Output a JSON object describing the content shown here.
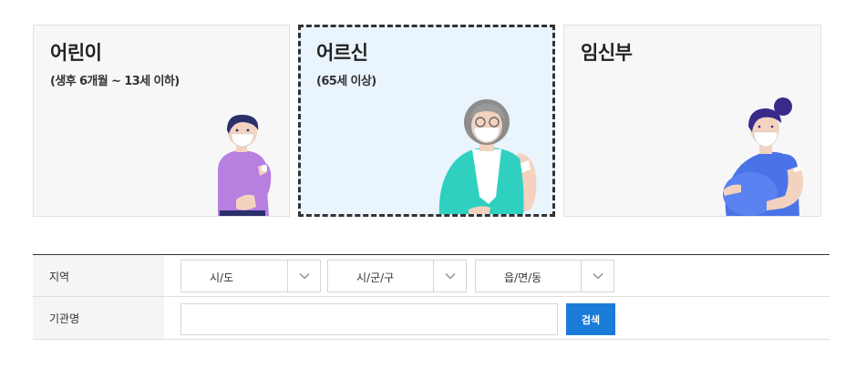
{
  "categories": [
    {
      "title": "어린이",
      "subtitle": "(생후 6개월 ~ 13세 이하)"
    },
    {
      "title": "어르신",
      "subtitle": "(65세 이상)"
    },
    {
      "title": "임신부",
      "subtitle": ""
    }
  ],
  "search_form": {
    "region_label": "지역",
    "region_selects": [
      {
        "value": "시/도"
      },
      {
        "value": "시/군/구"
      },
      {
        "value": "읍/면/동"
      }
    ],
    "institution_label": "기관명",
    "institution_value": "",
    "search_label": "검색"
  },
  "colors": {
    "selected_border": "#333333",
    "selected_bg": "#eaf4fd",
    "card_bg": "#f7f7f8",
    "button_blue": "#1a7bd9"
  }
}
